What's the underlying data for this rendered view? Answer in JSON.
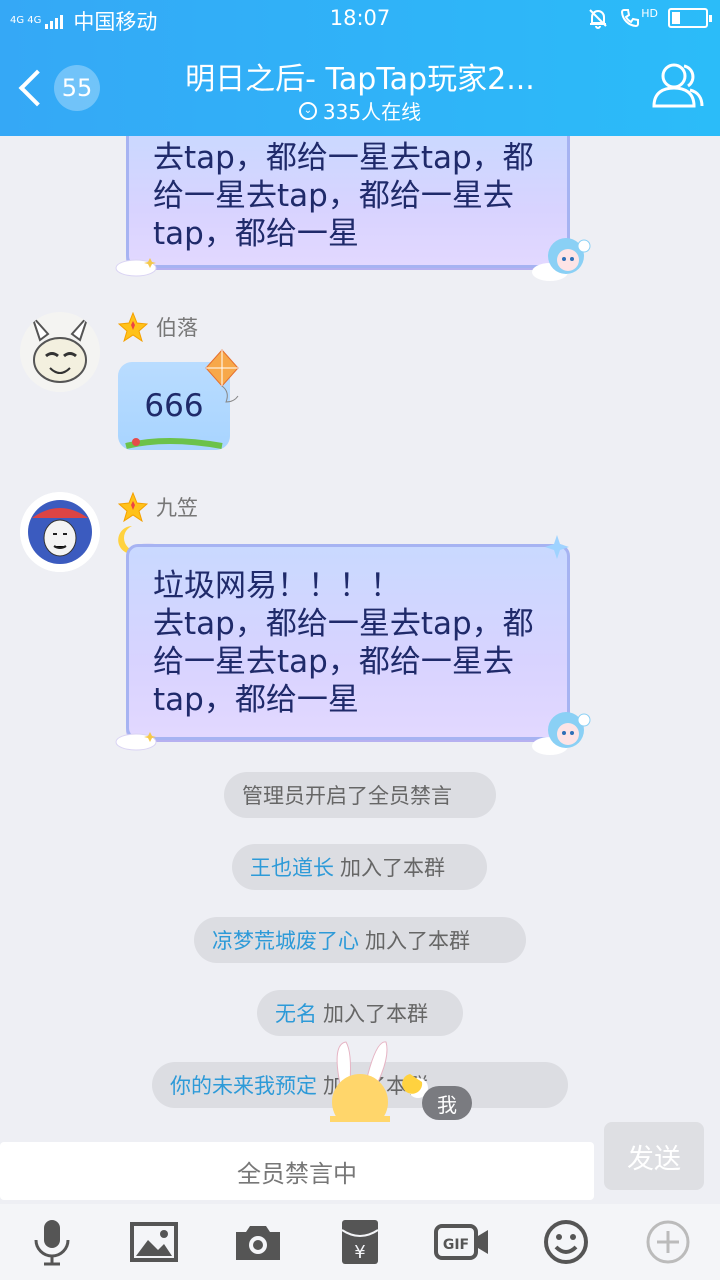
{
  "status_bar": {
    "network_label": "4G 4G",
    "carrier": "中国移动",
    "time": "18:07",
    "hd_label": "HD"
  },
  "title_bar": {
    "unread_count": "55",
    "group_name": "明日之后- TapTap玩家2...",
    "online_count": "335人在线"
  },
  "messages": {
    "top_bubble_partial": {
      "lines": [
        "去tap，都给一星去tap，都",
        "给一星去tap，都给一星去",
        "tap，都给一星"
      ]
    },
    "msg_1": {
      "nickname": "伯落",
      "text": "666"
    },
    "msg_2": {
      "nickname": "九笠",
      "lines": [
        "垃圾网易！！！！",
        "去tap，都给一星去tap，都",
        "给一星去tap，都给一星去",
        "tap，都给一星"
      ]
    }
  },
  "system_notices": [
    {
      "name": "",
      "text": "管理员开启了全员禁言"
    },
    {
      "name": "王也道长",
      "text": "加入了本群"
    },
    {
      "name": "凉梦荒城废了心",
      "text": "加入了本群"
    },
    {
      "name": "无名",
      "text": "加入了本群"
    },
    {
      "name": "你的未来我预定",
      "text": "加入了本群"
    }
  ],
  "floating_me_label": "我",
  "input": {
    "placeholder": "全员禁言中",
    "send_label": "发送"
  },
  "toolbar": {
    "icons": [
      "mic-icon",
      "image-icon",
      "camera-icon",
      "red-packet-icon",
      "gif-icon",
      "emoji-icon",
      "plus-icon"
    ]
  },
  "colors": {
    "header_blue": "#35a8f6",
    "link_blue": "#2d9ad8",
    "bubble_purple": "#c9d9ff"
  }
}
